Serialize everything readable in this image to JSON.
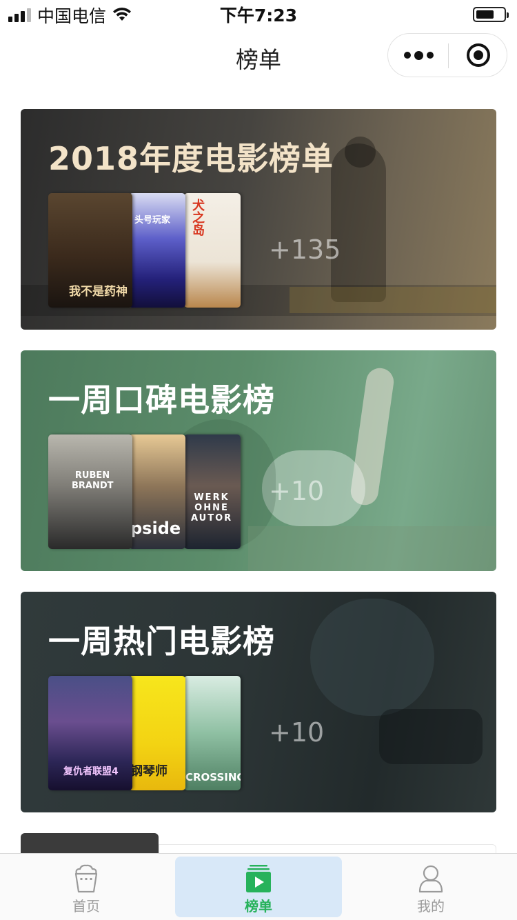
{
  "status_bar": {
    "carrier": "中国电信",
    "time": "下午7:23",
    "battery_level": 0.65
  },
  "nav": {
    "title": "榜单"
  },
  "cards": [
    {
      "title": "2018年度电影榜单",
      "count": "+135",
      "posters": [
        {
          "text": "我不是药神"
        },
        {
          "text": "头号玩家"
        },
        {
          "text": "犬之岛"
        }
      ]
    },
    {
      "title": "一周口碑电影榜",
      "count": "+10",
      "posters": [
        {
          "text": "RUBEN BRANDT"
        },
        {
          "text": "pside"
        },
        {
          "text": "WERK OHNE AUTOR"
        }
      ]
    },
    {
      "title": "一周热门电影榜",
      "count": "+10",
      "posters": [
        {
          "text": "复仇者联盟4"
        },
        {
          "text": "钢琴师"
        },
        {
          "text": "CROSSING"
        }
      ]
    }
  ],
  "tabs": [
    {
      "label": "首页",
      "icon": "popcorn-icon",
      "active": false
    },
    {
      "label": "榜单",
      "icon": "play-list-icon",
      "active": true
    },
    {
      "label": "我的",
      "icon": "user-icon",
      "active": false
    }
  ],
  "colors": {
    "accent": "#27b25b",
    "active_tab_bg": "#d8e8f8",
    "card_1_title": "#f3e3c8"
  }
}
